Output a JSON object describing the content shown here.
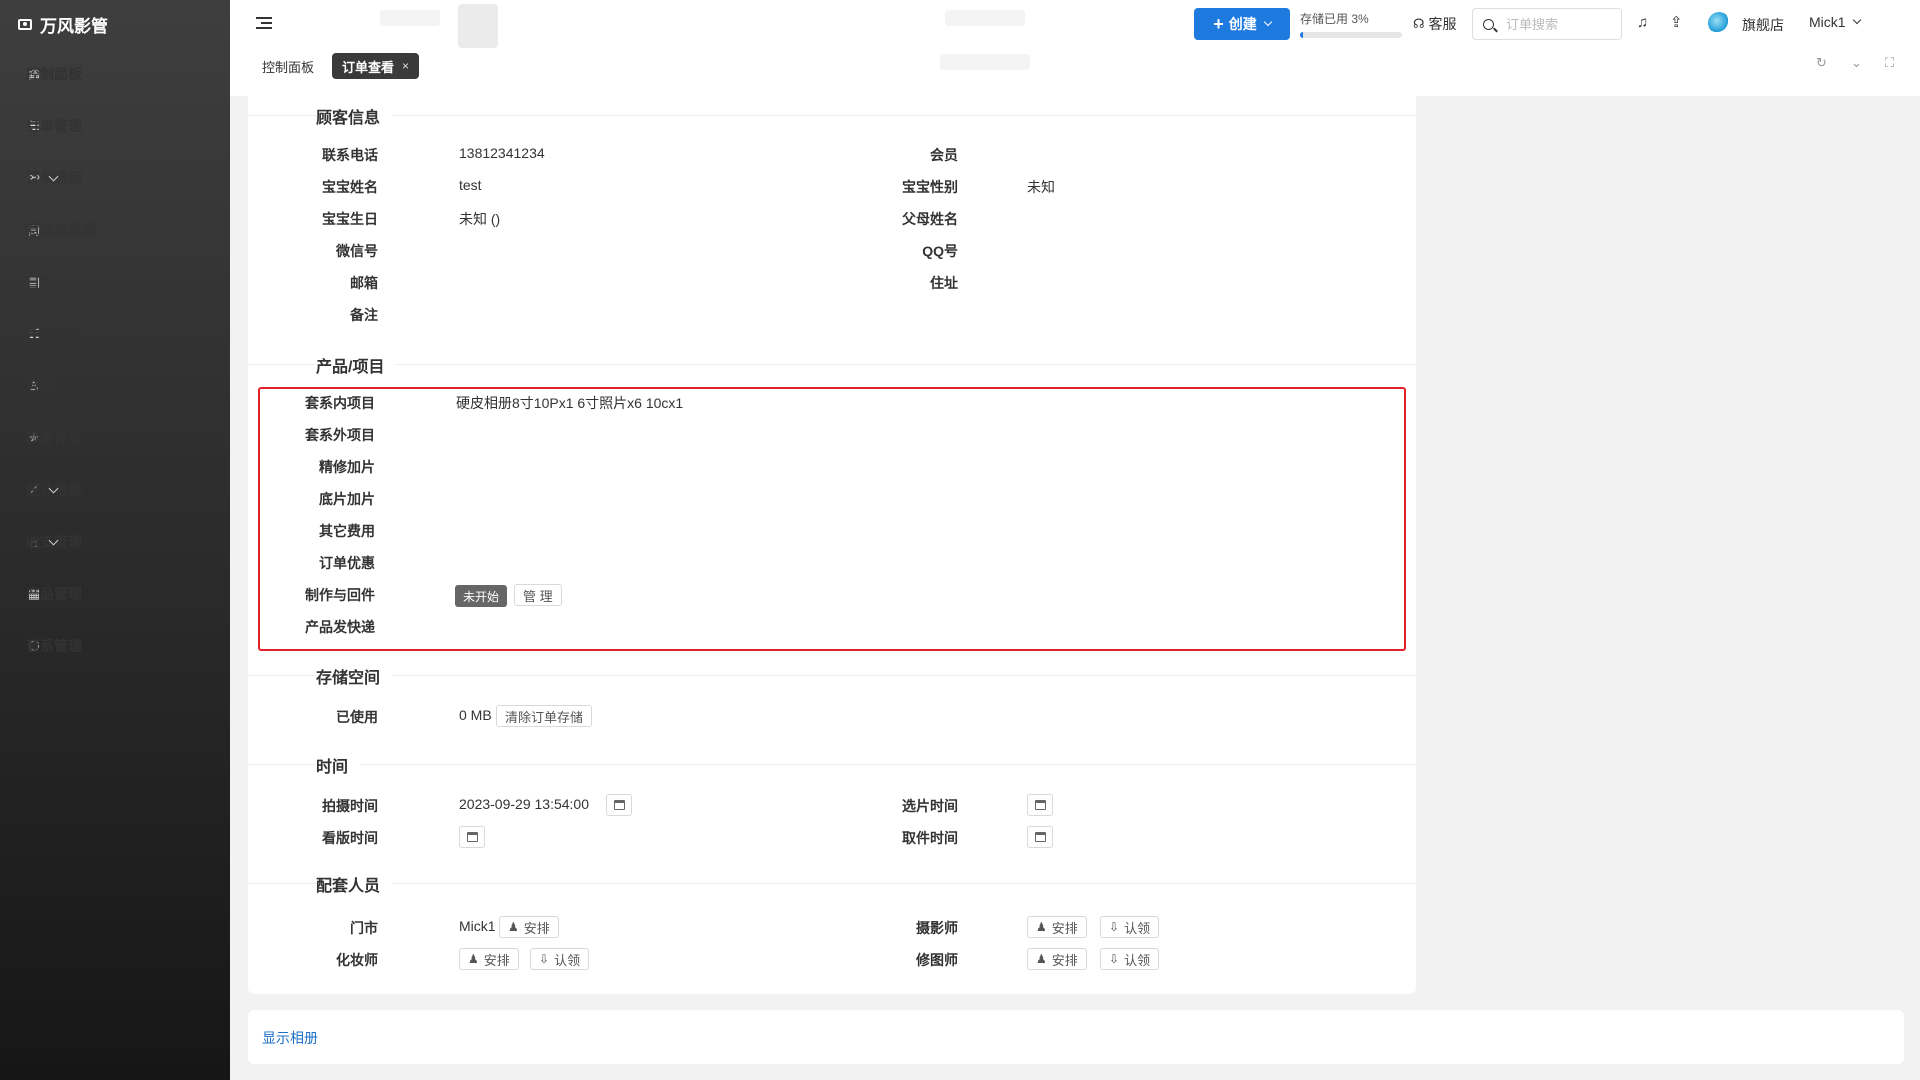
{
  "brand": {
    "name": "万风影管"
  },
  "sidebar": {
    "items": [
      {
        "label": "控制面板",
        "icon": "grid-icon",
        "glyph": "▦",
        "expandable": false
      },
      {
        "label": "订单管理",
        "icon": "list-icon",
        "glyph": "☰",
        "expandable": false
      },
      {
        "label": "订单流程",
        "icon": "flow-icon",
        "glyph": "⚯",
        "expandable": true
      },
      {
        "label": "意向单管理",
        "icon": "contact-icon",
        "glyph": "▣",
        "expandable": false
      },
      {
        "label": "日历",
        "icon": "calendar-icon",
        "glyph": "▤",
        "expandable": false
      },
      {
        "label": "任务管理",
        "icon": "task-list-icon",
        "glyph": "☷",
        "expandable": false
      },
      {
        "label": "会员",
        "icon": "user-icon",
        "glyph": "♙",
        "expandable": false
      },
      {
        "label": "顾客评价",
        "icon": "star-icon",
        "glyph": "★",
        "expandable": false
      },
      {
        "label": "统计报表",
        "icon": "chart-icon",
        "glyph": "⟋",
        "expandable": true
      },
      {
        "label": "收支管理",
        "icon": "bank-icon",
        "glyph": "⌂",
        "expandable": true
      },
      {
        "label": "产品管理",
        "icon": "product-icon",
        "glyph": "▦",
        "expandable": false
      },
      {
        "label": "套系管理",
        "icon": "package-icon",
        "glyph": "⬡",
        "expandable": false
      }
    ]
  },
  "header": {
    "tabs": [
      {
        "label": "控制面板",
        "active": false
      },
      {
        "label": "订单查看",
        "active": true,
        "close": "×"
      }
    ],
    "create_label": "创建",
    "create_plus": "+",
    "storage": {
      "label": "存储已用 3%",
      "percent": 3
    },
    "service_label": "客服",
    "service_glyph": "☊",
    "search_placeholder": "订单搜索",
    "bell_glyph": "♫",
    "upload_glyph": "⇪",
    "store_name": "旗舰店",
    "user_name": "Mick1",
    "tool_refresh": "↻",
    "tool_down": "⌄",
    "tool_full": "⛶"
  },
  "customer": {
    "title": "顾客信息",
    "left": [
      {
        "label": "联系电话",
        "value": "13812341234"
      },
      {
        "label": "宝宝姓名",
        "value": "test"
      },
      {
        "label": "宝宝生日",
        "value": "未知 ()"
      },
      {
        "label": "微信号",
        "value": ""
      },
      {
        "label": "邮箱",
        "value": ""
      },
      {
        "label": "备注",
        "value": ""
      }
    ],
    "right": [
      {
        "label": "会员",
        "value": ""
      },
      {
        "label": "宝宝性别",
        "value": "未知"
      },
      {
        "label": "父母姓名",
        "value": ""
      },
      {
        "label": "QQ号",
        "value": ""
      },
      {
        "label": "住址",
        "value": ""
      }
    ]
  },
  "products": {
    "title": "产品/项目",
    "rows": [
      {
        "label": "套系内项目",
        "value": "硬皮相册8寸10Px1 6寸照片x6 10cx1"
      },
      {
        "label": "套系外项目",
        "value": ""
      },
      {
        "label": "精修加片",
        "value": ""
      },
      {
        "label": "底片加片",
        "value": ""
      },
      {
        "label": "其它费用",
        "value": ""
      },
      {
        "label": "订单优惠",
        "value": ""
      },
      {
        "label": "制作与回件",
        "value": ""
      },
      {
        "label": "产品发快递",
        "value": ""
      }
    ],
    "status_badge": "未开始",
    "manage_label": "管 理"
  },
  "storage_space": {
    "title": "存储空间",
    "used_label": "已使用",
    "used_value": "0 MB",
    "clear_label": "清除订单存储"
  },
  "time": {
    "title": "时间",
    "shoot_label": "拍摄时间",
    "shoot_value": "2023-09-29 13:54:00",
    "select_label": "选片时间",
    "proof_label": "看版时间",
    "pickup_label": "取件时间"
  },
  "staff": {
    "title": "配套人员",
    "store_label": "门市",
    "store_value": "Mick1",
    "makeup_label": "化妆师",
    "photographer_label": "摄影师",
    "retoucher_label": "修图师",
    "assign_label": "安排",
    "claim_label": "认领",
    "assign_glyph": "♟",
    "claim_glyph": "⇩"
  },
  "album": {
    "link_label": "显示相册"
  },
  "colors": {
    "accent": "#1f7ae0",
    "highlight": "#e0232b",
    "sidebar": "#2a2a2a"
  }
}
